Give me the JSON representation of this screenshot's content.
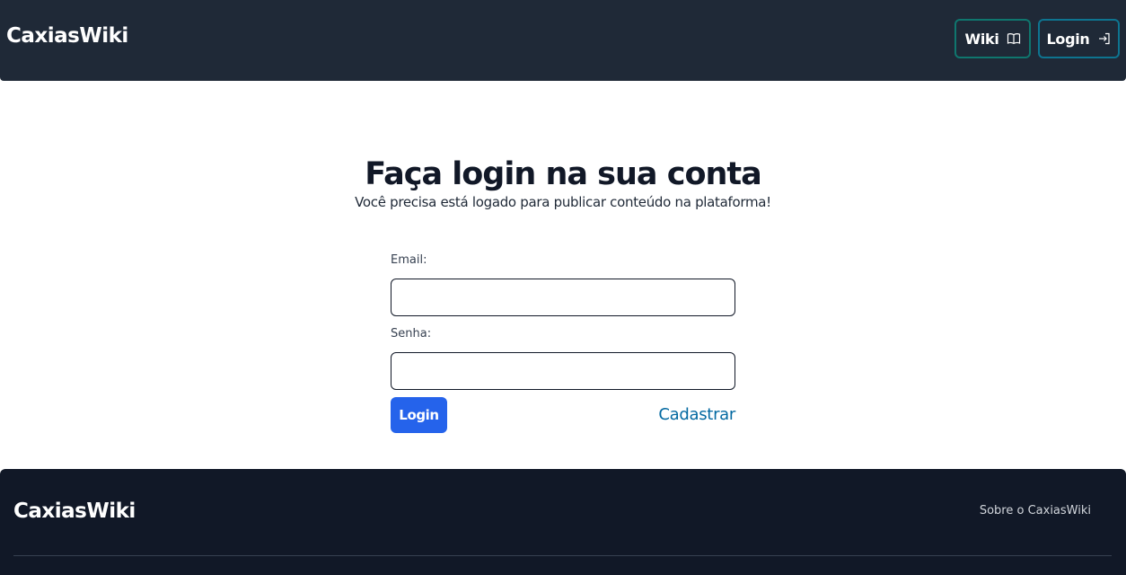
{
  "navbar": {
    "brand": "CaxiasWiki",
    "wiki_label": "Wiki",
    "wiki_icon": "book-open-icon",
    "login_label": "Login",
    "login_icon": "login-icon"
  },
  "main": {
    "title": "Faça login na sua conta",
    "subtitle": "Você precisa está logado para publicar conteúdo na plataforma!",
    "form": {
      "email_label": "Email:",
      "email_value": "",
      "password_label": "Senha:",
      "password_value": "",
      "submit_label": "Login",
      "register_label": "Cadastrar"
    }
  },
  "footer": {
    "brand": "CaxiasWiki",
    "about_link": "Sobre o CaxiasWiki"
  },
  "colors": {
    "navbar_bg": "#1f2937",
    "footer_bg": "#111827",
    "primary": "#2563eb",
    "link": "#0369a1",
    "wiki_border": "#0f766e",
    "login_border": "#0e7490"
  }
}
